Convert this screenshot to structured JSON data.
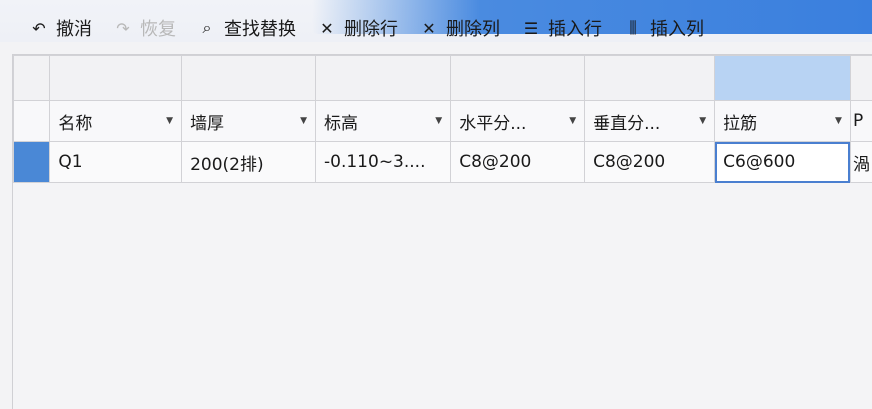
{
  "toolbar": {
    "undo": "撤消",
    "redo": "恢复",
    "find_replace": "查找替换",
    "delete_row": "删除行",
    "delete_col": "删除列",
    "insert_row": "插入行",
    "insert_col": "插入列"
  },
  "table": {
    "headers": [
      "名称",
      "墙厚",
      "标高",
      "水平分...",
      "垂直分...",
      "拉筋",
      "P"
    ],
    "rows": [
      [
        "Q1",
        "200(2排)",
        "-0.110~3....",
        "C8@200",
        "C8@200",
        "C6@600",
        "渦"
      ]
    ]
  },
  "colors": {
    "accent": "#3a7fde",
    "selection": "#4a88d6"
  }
}
